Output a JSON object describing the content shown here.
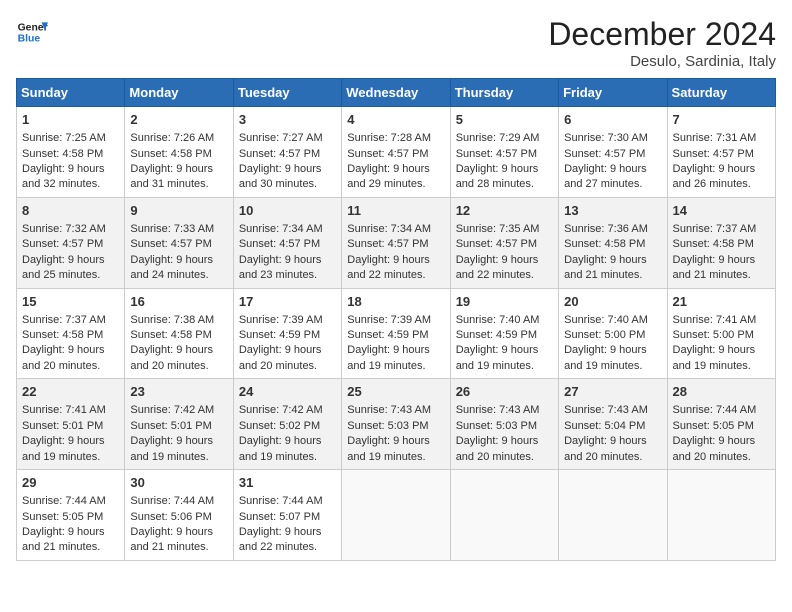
{
  "header": {
    "logo_line1": "General",
    "logo_line2": "Blue",
    "month": "December 2024",
    "location": "Desulo, Sardinia, Italy"
  },
  "days_of_week": [
    "Sunday",
    "Monday",
    "Tuesday",
    "Wednesday",
    "Thursday",
    "Friday",
    "Saturday"
  ],
  "weeks": [
    [
      {
        "day": 1,
        "sunrise": "7:25 AM",
        "sunset": "4:58 PM",
        "daylight": "9 hours and 32 minutes."
      },
      {
        "day": 2,
        "sunrise": "7:26 AM",
        "sunset": "4:58 PM",
        "daylight": "9 hours and 31 minutes."
      },
      {
        "day": 3,
        "sunrise": "7:27 AM",
        "sunset": "4:57 PM",
        "daylight": "9 hours and 30 minutes."
      },
      {
        "day": 4,
        "sunrise": "7:28 AM",
        "sunset": "4:57 PM",
        "daylight": "9 hours and 29 minutes."
      },
      {
        "day": 5,
        "sunrise": "7:29 AM",
        "sunset": "4:57 PM",
        "daylight": "9 hours and 28 minutes."
      },
      {
        "day": 6,
        "sunrise": "7:30 AM",
        "sunset": "4:57 PM",
        "daylight": "9 hours and 27 minutes."
      },
      {
        "day": 7,
        "sunrise": "7:31 AM",
        "sunset": "4:57 PM",
        "daylight": "9 hours and 26 minutes."
      }
    ],
    [
      {
        "day": 8,
        "sunrise": "7:32 AM",
        "sunset": "4:57 PM",
        "daylight": "9 hours and 25 minutes."
      },
      {
        "day": 9,
        "sunrise": "7:33 AM",
        "sunset": "4:57 PM",
        "daylight": "9 hours and 24 minutes."
      },
      {
        "day": 10,
        "sunrise": "7:34 AM",
        "sunset": "4:57 PM",
        "daylight": "9 hours and 23 minutes."
      },
      {
        "day": 11,
        "sunrise": "7:34 AM",
        "sunset": "4:57 PM",
        "daylight": "9 hours and 22 minutes."
      },
      {
        "day": 12,
        "sunrise": "7:35 AM",
        "sunset": "4:57 PM",
        "daylight": "9 hours and 22 minutes."
      },
      {
        "day": 13,
        "sunrise": "7:36 AM",
        "sunset": "4:58 PM",
        "daylight": "9 hours and 21 minutes."
      },
      {
        "day": 14,
        "sunrise": "7:37 AM",
        "sunset": "4:58 PM",
        "daylight": "9 hours and 21 minutes."
      }
    ],
    [
      {
        "day": 15,
        "sunrise": "7:37 AM",
        "sunset": "4:58 PM",
        "daylight": "9 hours and 20 minutes."
      },
      {
        "day": 16,
        "sunrise": "7:38 AM",
        "sunset": "4:58 PM",
        "daylight": "9 hours and 20 minutes."
      },
      {
        "day": 17,
        "sunrise": "7:39 AM",
        "sunset": "4:59 PM",
        "daylight": "9 hours and 20 minutes."
      },
      {
        "day": 18,
        "sunrise": "7:39 AM",
        "sunset": "4:59 PM",
        "daylight": "9 hours and 19 minutes."
      },
      {
        "day": 19,
        "sunrise": "7:40 AM",
        "sunset": "4:59 PM",
        "daylight": "9 hours and 19 minutes."
      },
      {
        "day": 20,
        "sunrise": "7:40 AM",
        "sunset": "5:00 PM",
        "daylight": "9 hours and 19 minutes."
      },
      {
        "day": 21,
        "sunrise": "7:41 AM",
        "sunset": "5:00 PM",
        "daylight": "9 hours and 19 minutes."
      }
    ],
    [
      {
        "day": 22,
        "sunrise": "7:41 AM",
        "sunset": "5:01 PM",
        "daylight": "9 hours and 19 minutes."
      },
      {
        "day": 23,
        "sunrise": "7:42 AM",
        "sunset": "5:01 PM",
        "daylight": "9 hours and 19 minutes."
      },
      {
        "day": 24,
        "sunrise": "7:42 AM",
        "sunset": "5:02 PM",
        "daylight": "9 hours and 19 minutes."
      },
      {
        "day": 25,
        "sunrise": "7:43 AM",
        "sunset": "5:03 PM",
        "daylight": "9 hours and 19 minutes."
      },
      {
        "day": 26,
        "sunrise": "7:43 AM",
        "sunset": "5:03 PM",
        "daylight": "9 hours and 20 minutes."
      },
      {
        "day": 27,
        "sunrise": "7:43 AM",
        "sunset": "5:04 PM",
        "daylight": "9 hours and 20 minutes."
      },
      {
        "day": 28,
        "sunrise": "7:44 AM",
        "sunset": "5:05 PM",
        "daylight": "9 hours and 20 minutes."
      }
    ],
    [
      {
        "day": 29,
        "sunrise": "7:44 AM",
        "sunset": "5:05 PM",
        "daylight": "9 hours and 21 minutes."
      },
      {
        "day": 30,
        "sunrise": "7:44 AM",
        "sunset": "5:06 PM",
        "daylight": "9 hours and 21 minutes."
      },
      {
        "day": 31,
        "sunrise": "7:44 AM",
        "sunset": "5:07 PM",
        "daylight": "9 hours and 22 minutes."
      },
      null,
      null,
      null,
      null
    ]
  ],
  "labels": {
    "sunrise": "Sunrise:",
    "sunset": "Sunset:",
    "daylight": "Daylight:"
  }
}
